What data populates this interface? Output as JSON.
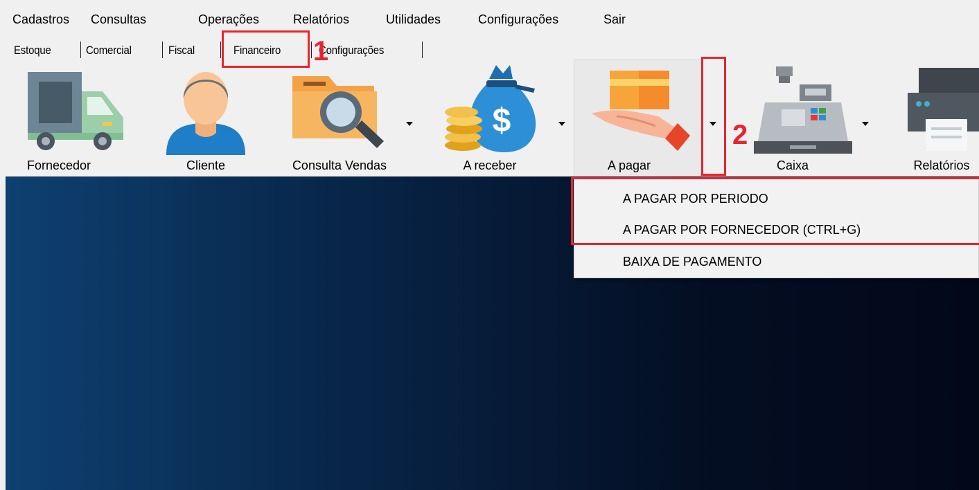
{
  "menubar": {
    "items": [
      "Cadastros",
      "Consultas",
      "Operações",
      "Relatórios",
      "Utilidades",
      "Configurações",
      "Sair"
    ]
  },
  "tabs": {
    "items": [
      "Estoque",
      "Comercial",
      "Fiscal",
      "Financeiro",
      "Configurações"
    ],
    "active": "Financeiro"
  },
  "toolbar": {
    "items": [
      {
        "label": "Fornecedor",
        "icon": "truck-icon"
      },
      {
        "label": "Cliente",
        "icon": "user-icon"
      },
      {
        "label": "Consulta Vendas",
        "icon": "folder-search-icon"
      },
      {
        "label": "A receber",
        "icon": "money-bag-icon"
      },
      {
        "label": "A pagar",
        "icon": "card-payment-icon"
      },
      {
        "label": "Caixa",
        "icon": "cash-register-icon"
      },
      {
        "label": "Relatórios",
        "icon": "printer-icon"
      }
    ]
  },
  "dropdown": {
    "items": [
      "A PAGAR POR PERIODO",
      "A PAGAR POR FORNECEDOR (CTRL+G)",
      "BAIXA DE PAGAMENTO"
    ]
  },
  "annotations": {
    "marker_1": "1",
    "marker_2": "2",
    "color": "#e8242e"
  },
  "colors": {
    "background_gradient_start": "#0e4070",
    "background_gradient_end": "#020818",
    "annotation_red": "#e8242e"
  }
}
